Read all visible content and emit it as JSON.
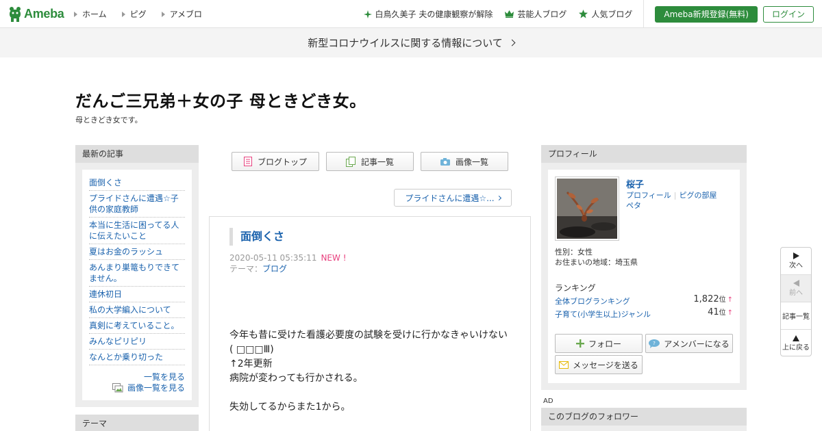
{
  "header": {
    "logo_text": "Ameba",
    "nav": [
      {
        "label": "ホーム"
      },
      {
        "label": "ピグ"
      },
      {
        "label": "アメブロ"
      }
    ],
    "right_links": [
      {
        "label": "白鳥久美子 夫の健康観察が解除",
        "icon": "sparkle-icon"
      },
      {
        "label": "芸能人ブログ",
        "icon": "crown-icon"
      },
      {
        "label": "人気ブログ",
        "icon": "star-icon"
      }
    ],
    "register_label": "Ameba新規登録(無料)",
    "login_label": "ログイン",
    "brand_color": "#2d8c3c"
  },
  "banner": {
    "text": "新型コロナウイルスに関する情報について"
  },
  "blog": {
    "title": "だんご三兄弟＋女の子 母ときどき女。",
    "description": "母ときどき女です。"
  },
  "left": {
    "recent_heading": "最新の記事",
    "recent_items": [
      "面倒くさ",
      "プライドさんに遭遇☆子供の家庭教師",
      "本当に生活に困ってる人に伝えたいこと",
      "夏はお金のラッシュ",
      "あんまり巣篭もりできてません。",
      "連休初日",
      "私の大学編入について",
      "真剣に考えていること。",
      "みんなピリピリ",
      "なんとか乗り切った"
    ],
    "see_list": "一覧を見る",
    "see_images": "画像一覧を見る",
    "theme_heading": "テーマ"
  },
  "center": {
    "tabs": [
      {
        "label": "ブログトップ",
        "icon": "document-icon"
      },
      {
        "label": "記事一覧",
        "icon": "pages-icon"
      },
      {
        "label": "画像一覧",
        "icon": "camera-icon"
      }
    ],
    "next_article": "プライドさんに遭遇☆...",
    "article": {
      "title": "面倒くさ",
      "date": "2020-05-11 05:35:11",
      "new_badge": "NEW !",
      "theme_label": "テーマ：",
      "theme": "ブログ",
      "body": [
        "今年も昔に受けた看護必要度の試験を受けに行かなきゃいけない",
        "( □□□Ⅲ)",
        "↑2年更新",
        "病院が変わっても行かされる。",
        "",
        "失効してるからまた1から。"
      ]
    }
  },
  "profile": {
    "heading": "プロフィール",
    "name": "桜子",
    "link_profile": "プロフィール",
    "link_pig": "ピグの部屋",
    "link_peta": "ペタ",
    "gender": "性別：女性",
    "location": "お住まいの地域：埼玉県",
    "ranking_heading": "ランキング",
    "rankings": [
      {
        "label": "全体ブログランキング",
        "value": "1,822",
        "unit": "位",
        "trend": "↑"
      },
      {
        "label": "子育て(小学生以上)ジャンル",
        "value": "41",
        "unit": "位",
        "trend": "↑"
      }
    ],
    "follow_label": "フォロー",
    "amember_label": "アメンバーになる",
    "message_label": "メッセージを送る"
  },
  "ad_label": "AD",
  "followers_heading": "このブログのフォロワー",
  "float_nav": {
    "next": "次へ",
    "prev": "前へ",
    "list": "記事一覧",
    "top": "上に戻る"
  }
}
